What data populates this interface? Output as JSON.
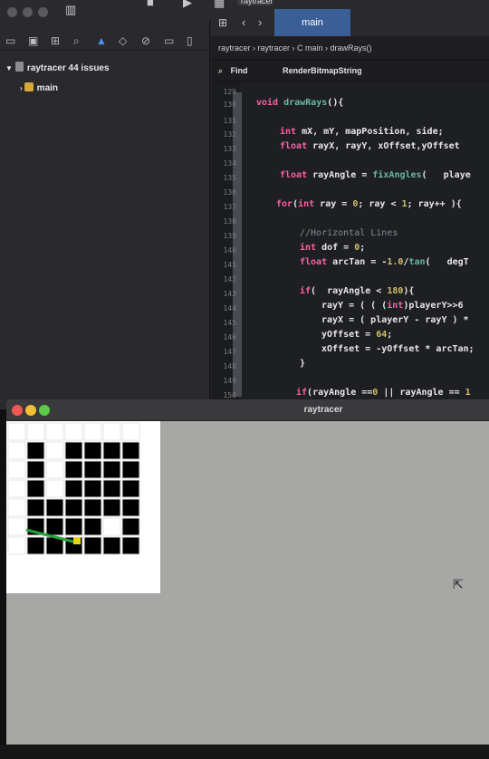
{
  "xcode": {
    "scheme_label": "raytracer",
    "tab_label": "main",
    "breadcrumb": "raytracer  ›  raytracer  ›  C  main  ›  drawRays()",
    "find_label": "Find",
    "find_query": "RenderBitmapString",
    "navigator": {
      "project_label": "raytracer 44 issues",
      "file_label": "main"
    },
    "line_numbers": [
      "129",
      "130",
      "131",
      "132",
      "133",
      "134",
      "135",
      "136",
      "137",
      "138",
      "139",
      "140",
      "141",
      "142",
      "143",
      "144",
      "145",
      "146",
      "147",
      "148",
      "149",
      "150"
    ]
  },
  "raytracer": {
    "title": "raytracer",
    "map_rows": 6,
    "map_cols": 7,
    "map_wall_color": "#000000",
    "map_floor_color": "#ffffff",
    "player_color": "#e3d51b",
    "ray_color": "#26a13a"
  }
}
